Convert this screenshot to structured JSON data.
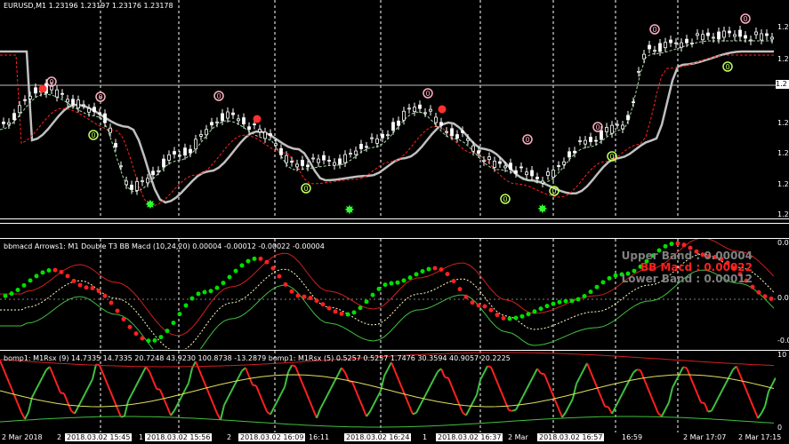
{
  "main": {
    "title": "EURUSD,M1  1.23196 1.23197 1.23176 1.23178",
    "price_scale": [
      "1.2",
      "1.2",
      "1.2",
      "1.2",
      "1.2",
      "1.2",
      "1.2"
    ],
    "price_marker": "1.2",
    "signal_label": "0"
  },
  "macd": {
    "title": "bbmacd Arrows1: M1 Double T3 BB Macd (10,24,20) 0.00004 -0.00012 -0.00022 -0.00004",
    "upper_band": "Upper Band : 0.00004",
    "bb_macd": "BB Macd : 0.00022",
    "lower_band": "Lower Band : 0.00012",
    "scale": [
      "0.0",
      "0.0",
      "-0.0",
      "-0.0"
    ],
    "colors": {
      "up": "#00e000",
      "down": "#ff2020",
      "upper": "#d02020",
      "lower": "#40c040",
      "mid": "#ffffc0"
    }
  },
  "rsx": {
    "title": "bomp1: M1Rsx (9) 14.7335 14.7335 20.7248 43.9230 100.8738 -13.2879  bomp1: M1Rsx (5) 0.5257 0.5257 1.7476 30.3594 40.9057 20.2225",
    "scale": [
      "10",
      "0"
    ]
  },
  "time_axis": [
    {
      "text": "2 Mar 2018",
      "box": false
    },
    {
      "text": "2",
      "box": false
    },
    {
      "text": "2018.03.02 15:45",
      "box": true
    },
    {
      "text": "1",
      "box": false
    },
    {
      "text": "2018.03.02 15:56",
      "box": true
    },
    {
      "text": "2",
      "box": false
    },
    {
      "text": "2018.03.02 16:09",
      "box": true
    },
    {
      "text": "16:11",
      "box": false
    },
    {
      "text": "2018.03.02 16:24",
      "box": true
    },
    {
      "text": "1",
      "box": false
    },
    {
      "text": "2018.03.02 16:37",
      "box": true
    },
    {
      "text": "2 Mar",
      "box": false
    },
    {
      "text": "2018.03.02 16:57",
      "box": true
    },
    {
      "text": "16:59",
      "box": false
    },
    {
      "text": "2 Mar 17:07",
      "box": false
    },
    {
      "text": "2 Mar 17:15",
      "box": false
    }
  ],
  "colors": {
    "background": "#000000",
    "candle": "#ffffff",
    "ma_slow": "#c0c0c0",
    "ma_fast_dash": "#a0e0a0",
    "ma_red_dash": "#ff2020",
    "sell_marker": "#ff3030",
    "buy_marker": "#30ff30",
    "signal_pink": "#ffb0c0",
    "signal_green": "#c0ff60"
  }
}
